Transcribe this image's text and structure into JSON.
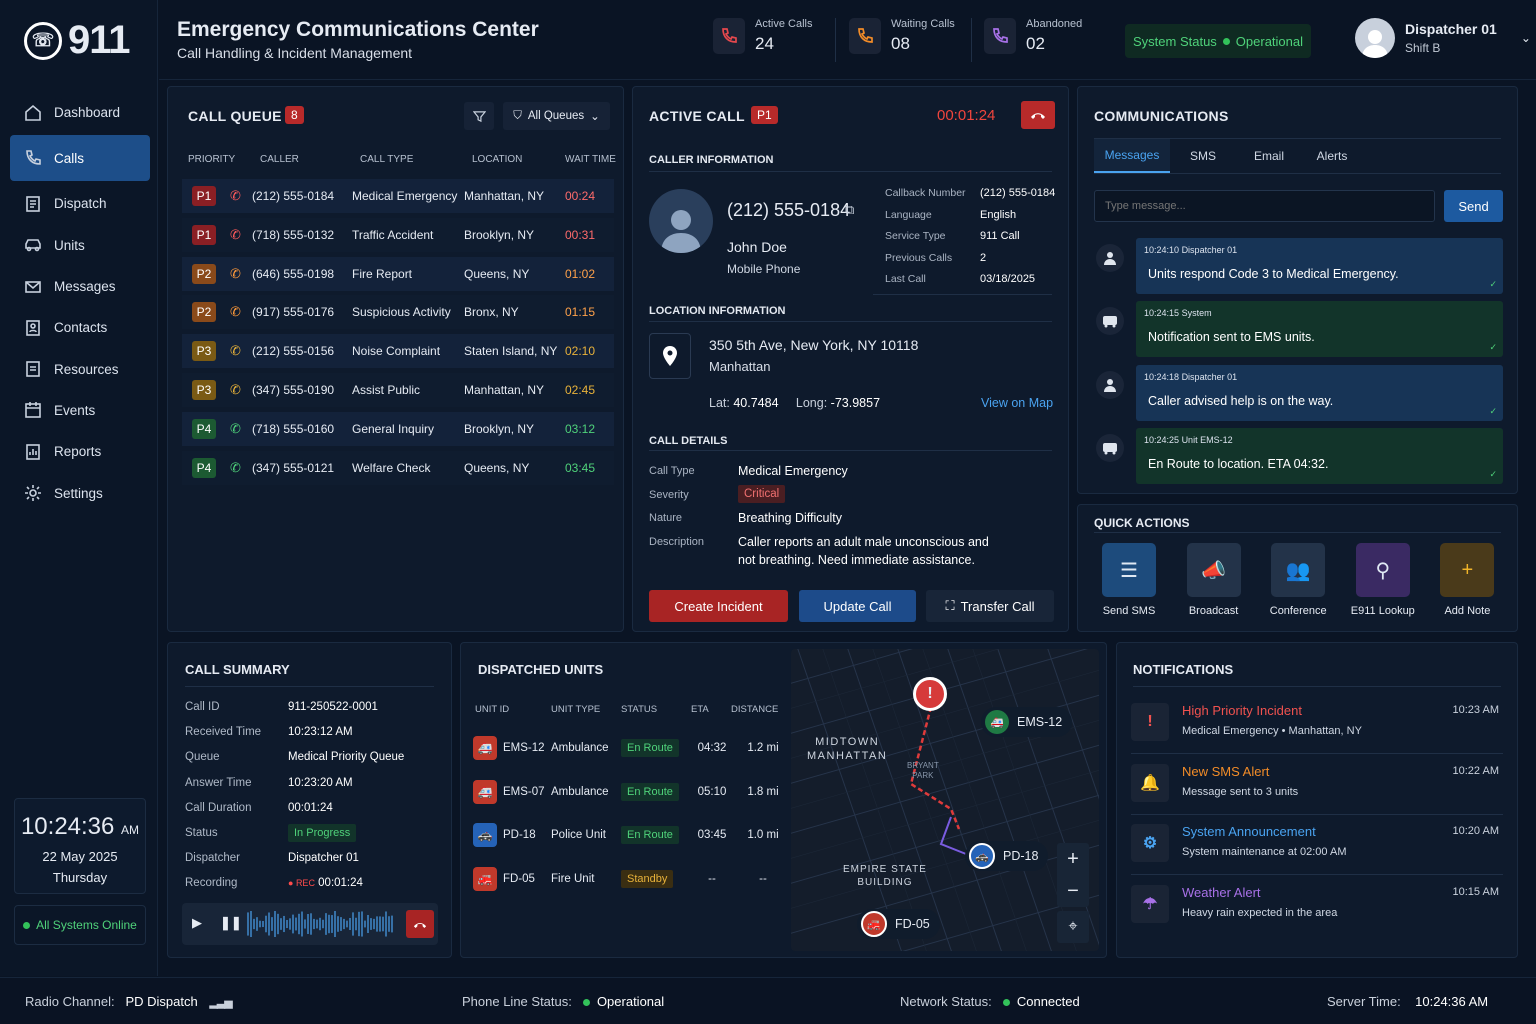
{
  "app": {
    "logo_text": "911"
  },
  "nav": [
    {
      "label": "Dashboard",
      "icon": "home-icon"
    },
    {
      "label": "Calls",
      "icon": "phone-icon"
    },
    {
      "label": "Dispatch",
      "icon": "dispatch-icon"
    },
    {
      "label": "Units",
      "icon": "car-icon"
    },
    {
      "label": "Messages",
      "icon": "mail-icon"
    },
    {
      "label": "Contacts",
      "icon": "contacts-icon"
    },
    {
      "label": "Resources",
      "icon": "resources-icon"
    },
    {
      "label": "Events",
      "icon": "calendar-icon"
    },
    {
      "label": "Reports",
      "icon": "reports-icon"
    },
    {
      "label": "Settings",
      "icon": "gear-icon"
    }
  ],
  "clock": {
    "time": "10:24:36",
    "ampm": "AM",
    "date": "22 May 2025",
    "weekday": "Thursday"
  },
  "systems": "All Systems Online",
  "header": {
    "title": "Emergency Communications Center",
    "subtitle": "Call Handling & Incident Management",
    "stats": [
      {
        "label": "Active Calls",
        "value": "24",
        "color": "#e5484d"
      },
      {
        "label": "Waiting Calls",
        "value": "08",
        "color": "#f28c28"
      },
      {
        "label": "Abandoned",
        "value": "02",
        "color": "#a871e8"
      }
    ],
    "system_status_label": "System Status",
    "system_status_value": "Operational",
    "user_name": "Dispatcher 01",
    "user_shift": "Shift B"
  },
  "queue": {
    "title": "CALL QUEUE",
    "count": "8",
    "filter": "All Queues",
    "columns": [
      "PRIORITY",
      "CALLER",
      "CALL TYPE",
      "LOCATION",
      "WAIT TIME"
    ],
    "rows": [
      {
        "p": "P1",
        "caller": "(212) 555-0184",
        "type": "Medical Emergency",
        "loc": "Manhattan, NY",
        "wait": "00:24"
      },
      {
        "p": "P1",
        "caller": "(718) 555-0132",
        "type": "Traffic Accident",
        "loc": "Brooklyn, NY",
        "wait": "00:31"
      },
      {
        "p": "P2",
        "caller": "(646) 555-0198",
        "type": "Fire Report",
        "loc": "Queens, NY",
        "wait": "01:02"
      },
      {
        "p": "P2",
        "caller": "(917) 555-0176",
        "type": "Suspicious Activity",
        "loc": "Bronx, NY",
        "wait": "01:15"
      },
      {
        "p": "P3",
        "caller": "(212) 555-0156",
        "type": "Noise Complaint",
        "loc": "Staten Island, NY",
        "wait": "02:10"
      },
      {
        "p": "P3",
        "caller": "(347) 555-0190",
        "type": "Assist Public",
        "loc": "Manhattan, NY",
        "wait": "02:45"
      },
      {
        "p": "P4",
        "caller": "(718) 555-0160",
        "type": "General Inquiry",
        "loc": "Brooklyn, NY",
        "wait": "03:12"
      },
      {
        "p": "P4",
        "caller": "(347) 555-0121",
        "type": "Welfare Check",
        "loc": "Queens, NY",
        "wait": "03:45"
      }
    ]
  },
  "active": {
    "title": "ACTIVE CALL",
    "priority": "P1",
    "timer": "00:01:24",
    "caller_section": "CALLER INFORMATION",
    "phone": "(212) 555-0184",
    "name": "John Doe",
    "phone_type": "Mobile Phone",
    "info": [
      {
        "k": "Callback Number",
        "v": "(212) 555-0184"
      },
      {
        "k": "Language",
        "v": "English"
      },
      {
        "k": "Service Type",
        "v": "911 Call"
      },
      {
        "k": "Previous Calls",
        "v": "2"
      },
      {
        "k": "Last Call",
        "v": "03/18/2025"
      }
    ],
    "location_section": "LOCATION INFORMATION",
    "address": "350 5th Ave, New York, NY 10118",
    "borough": "Manhattan",
    "lat_label": "Lat:",
    "lat": "40.7484",
    "long_label": "Long:",
    "long": "-73.9857",
    "map_link": "View on Map",
    "details_section": "CALL DETAILS",
    "details": {
      "type_k": "Call Type",
      "type_v": "Medical Emergency",
      "sev_k": "Severity",
      "sev_v": "Critical",
      "nature_k": "Nature",
      "nature_v": "Breathing Difficulty",
      "desc_k": "Description",
      "desc_1": "Caller reports an adult male unconscious and",
      "desc_2": "not breathing. Need immediate assistance."
    },
    "btn_create": "Create Incident",
    "btn_update": "Update Call",
    "btn_transfer": "Transfer Call"
  },
  "comms": {
    "title": "COMMUNICATIONS",
    "tabs": [
      "Messages",
      "SMS",
      "Email",
      "Alerts"
    ],
    "placeholder": "Type message...",
    "send": "Send",
    "messages": [
      {
        "time": "10:24:10",
        "from": "Dispatcher 01",
        "text": "Units respond Code 3 to Medical Emergency.",
        "bg": "#173456"
      },
      {
        "time": "10:24:15",
        "from": "System",
        "text": "Notification sent to EMS units.",
        "bg": "#12342a"
      },
      {
        "time": "10:24:18",
        "from": "Dispatcher 01",
        "text": "Caller advised help is on the way.",
        "bg": "#173456"
      },
      {
        "time": "10:24:25",
        "from": "Unit EMS-12",
        "text": "En Route to location. ETA 04:32.",
        "bg": "#12342a"
      }
    ]
  },
  "quick": {
    "title": "QUICK ACTIONS",
    "items": [
      {
        "label": "Send SMS",
        "bg": "#1d4b7c",
        "icon": "sms-icon"
      },
      {
        "label": "Broadcast",
        "bg": "#233349",
        "icon": "megaphone-icon"
      },
      {
        "label": "Conference",
        "bg": "#233349",
        "icon": "conference-icon"
      },
      {
        "label": "E911 Lookup",
        "bg": "#3a2a63",
        "icon": "location-pin-icon"
      },
      {
        "label": "Add Note",
        "bg": "#4a3a1a",
        "icon": "add-note-icon"
      }
    ]
  },
  "summary": {
    "title": "CALL SUMMARY",
    "rows": [
      {
        "k": "Call ID",
        "v": "911-250522-0001"
      },
      {
        "k": "Received Time",
        "v": "10:23:12 AM"
      },
      {
        "k": "Queue",
        "v": "Medical Priority Queue"
      },
      {
        "k": "Answer Time",
        "v": "10:23:20 AM"
      },
      {
        "k": "Call Duration",
        "v": "00:01:24"
      },
      {
        "k": "Status",
        "v": "In Progress"
      },
      {
        "k": "Dispatcher",
        "v": "Dispatcher 01"
      },
      {
        "k": "Recording",
        "v": "00:01:24"
      }
    ],
    "rec": "REC"
  },
  "units": {
    "title": "DISPATCHED UNITS",
    "columns": [
      "UNIT ID",
      "UNIT TYPE",
      "STATUS",
      "ETA",
      "DISTANCE"
    ],
    "rows": [
      {
        "id": "EMS-12",
        "type": "Ambulance",
        "status": "En Route",
        "eta": "04:32",
        "dist": "1.2 mi",
        "color": "#c0392b"
      },
      {
        "id": "EMS-07",
        "type": "Ambulance",
        "status": "En Route",
        "eta": "05:10",
        "dist": "1.8 mi",
        "color": "#c0392b"
      },
      {
        "id": "PD-18",
        "type": "Police Unit",
        "status": "En Route",
        "eta": "03:45",
        "dist": "1.0 mi",
        "color": "#2563b8"
      },
      {
        "id": "FD-05",
        "type": "Fire Unit",
        "status": "Standby",
        "eta": "--",
        "dist": "--",
        "color": "#c0392b"
      }
    ],
    "map": {
      "area1": "MIDTOWN",
      "area2": "MANHATTAN",
      "park1": "BRYANT",
      "park2": "PARK",
      "landmark1": "EMPIRE STATE",
      "landmark2": "BUILDING",
      "u1": "EMS-12",
      "u2": "PD-18",
      "u3": "FD-05"
    }
  },
  "notifications": {
    "title": "NOTIFICATIONS",
    "items": [
      {
        "title": "High Priority Incident",
        "sub": "Medical Emergency • Manhattan, NY",
        "time": "10:23 AM",
        "color": "#f0524f"
      },
      {
        "title": "New SMS Alert",
        "sub": "Message sent to 3 units",
        "time": "10:22 AM",
        "color": "#f28c28"
      },
      {
        "title": "System Announcement",
        "sub": "System maintenance at 02:00 AM",
        "time": "10:20 AM",
        "color": "#4aa3f0"
      },
      {
        "title": "Weather Alert",
        "sub": "Heavy rain expected in the area",
        "time": "10:15 AM",
        "color": "#a871e8"
      }
    ]
  },
  "footer": {
    "radio_k": "Radio Channel:",
    "radio_v": "PD Dispatch",
    "phone_k": "Phone Line Status:",
    "phone_v": "Operational",
    "net_k": "Network Status:",
    "net_v": "Connected",
    "server_k": "Server Time:",
    "server_v": "10:24:36 AM"
  }
}
